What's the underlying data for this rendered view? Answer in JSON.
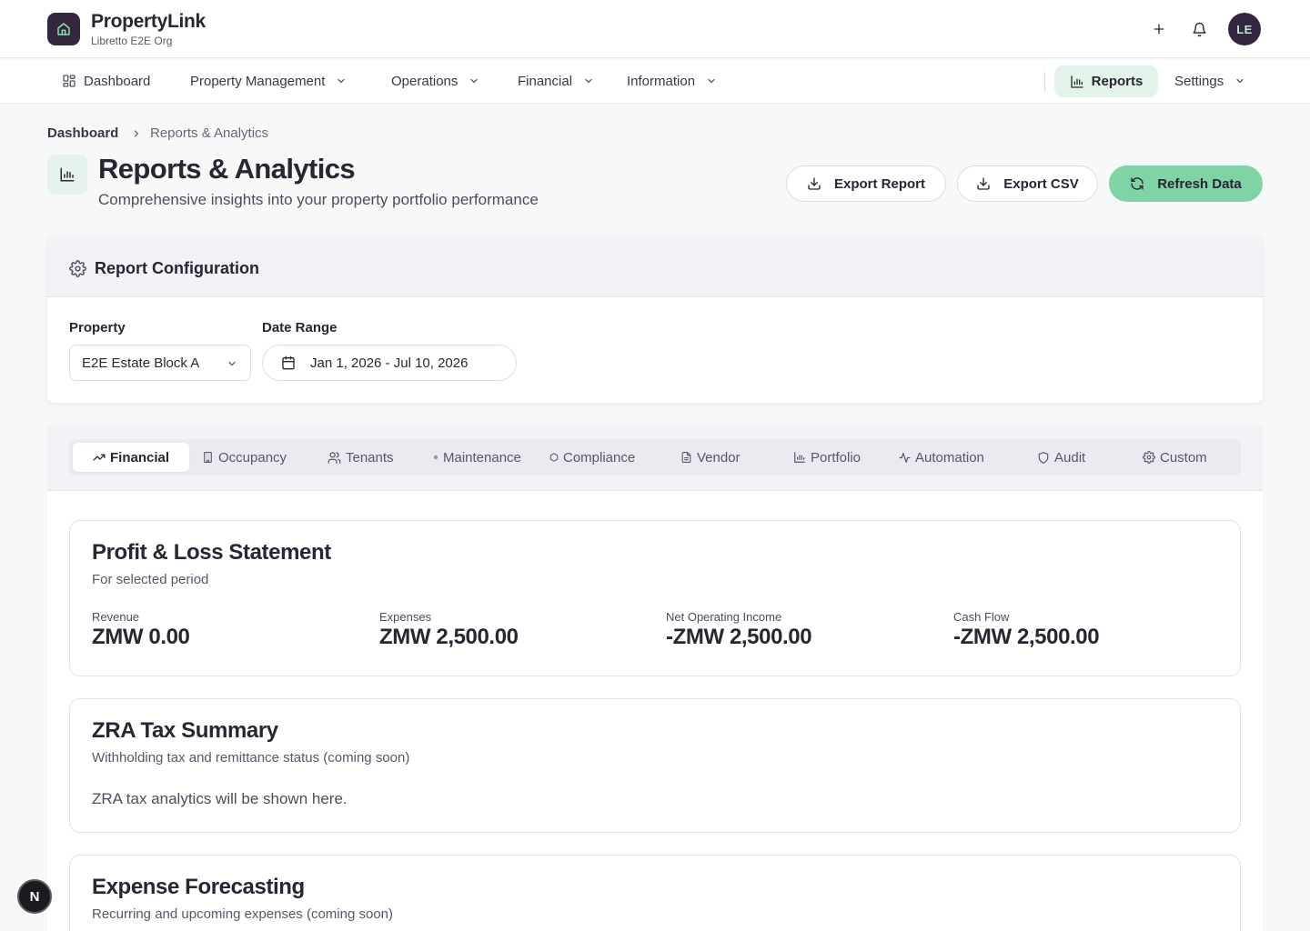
{
  "header": {
    "brand": "PropertyLink",
    "org": "Libretto E2E Org",
    "avatar_initials": "LE",
    "icons": [
      "plus-icon",
      "bell-icon"
    ]
  },
  "nav": {
    "items": [
      {
        "label": "Dashboard",
        "icon": "grid-icon",
        "dropdown": false
      },
      {
        "label": "Property Management",
        "dropdown": true
      },
      {
        "label": "Operations",
        "dropdown": true
      },
      {
        "label": "Financial",
        "dropdown": true
      },
      {
        "label": "Information",
        "dropdown": true
      }
    ],
    "reports": {
      "label": "Reports",
      "icon": "bar-chart-icon",
      "active": true
    },
    "settings": {
      "label": "Settings",
      "dropdown": true
    }
  },
  "breadcrumb": {
    "home": "Dashboard",
    "current": "Reports & Analytics"
  },
  "page": {
    "title": "Reports & Analytics",
    "subtitle": "Comprehensive insights into your property portfolio performance"
  },
  "actions": {
    "export_report": "Export Report",
    "export_csv": "Export CSV",
    "refresh": "Refresh Data"
  },
  "config": {
    "title": "Report Configuration",
    "property_label": "Property",
    "property_value": "E2E Estate Block A",
    "date_label": "Date Range",
    "date_value": "Jan 1, 2026 - Jul 10, 2026"
  },
  "tabs": [
    {
      "label": "Financial",
      "icon": "trending-up-icon",
      "active": true
    },
    {
      "label": "Occupancy",
      "icon": "building-icon"
    },
    {
      "label": "Tenants",
      "icon": "users-icon"
    },
    {
      "label": "Maintenance",
      "icon": "dot-icon"
    },
    {
      "label": "Compliance",
      "icon": "hexagon-icon"
    },
    {
      "label": "Vendor",
      "icon": "document-icon"
    },
    {
      "label": "Portfolio",
      "icon": "bar-chart-icon"
    },
    {
      "label": "Automation",
      "icon": "activity-icon"
    },
    {
      "label": "Audit",
      "icon": "shield-icon"
    },
    {
      "label": "Custom",
      "icon": "gear-icon"
    }
  ],
  "pnl": {
    "title": "Profit & Loss Statement",
    "subtitle": "For selected period",
    "metrics": [
      {
        "label": "Revenue",
        "value": "ZMW 0.00"
      },
      {
        "label": "Expenses",
        "value": "ZMW 2,500.00"
      },
      {
        "label": "Net Operating Income",
        "value": "-ZMW 2,500.00"
      },
      {
        "label": "Cash Flow",
        "value": "-ZMW 2,500.00"
      }
    ]
  },
  "tax": {
    "title": "ZRA Tax Summary",
    "subtitle": "Withholding tax and remittance status (coming soon)",
    "body": "ZRA tax analytics will be shown here."
  },
  "forecast": {
    "title": "Expense Forecasting",
    "subtitle": "Recurring and upcoming expenses (coming soon)"
  },
  "dev_badge": "N",
  "colors": {
    "brand_dark": "#33273f",
    "accent_green": "#7fd3a4",
    "active_tint": "#e3f3ea"
  }
}
